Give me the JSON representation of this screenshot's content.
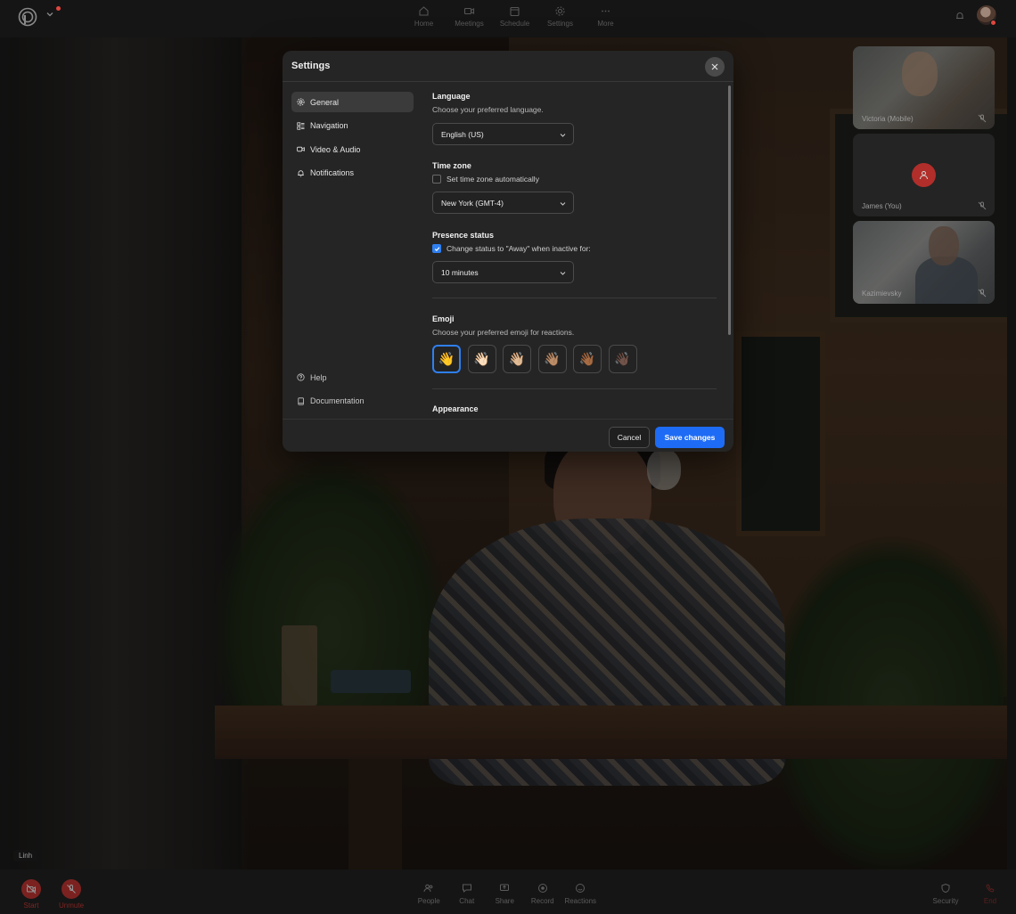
{
  "topbar": {
    "nav": [
      {
        "label": "Home",
        "icon": "home-icon"
      },
      {
        "label": "Meetings",
        "icon": "video-icon"
      },
      {
        "label": "Schedule",
        "icon": "calendar-icon"
      },
      {
        "label": "Settings",
        "icon": "gear-icon"
      },
      {
        "label": "More",
        "icon": "more-icon"
      }
    ]
  },
  "stage": {
    "speaker_name": "Linh"
  },
  "participants": [
    {
      "name": "Victoria (Mobile)"
    },
    {
      "name": "James (You)"
    },
    {
      "name": "Kazimievsky"
    }
  ],
  "modal": {
    "title": "Settings",
    "sidebar": {
      "items": [
        {
          "label": "General",
          "icon": "gear-icon",
          "active": true
        },
        {
          "label": "Navigation",
          "icon": "grid-list-icon",
          "active": false
        },
        {
          "label": "Video & Audio",
          "icon": "camera-icon",
          "active": false
        },
        {
          "label": "Notifications",
          "icon": "bell-icon",
          "active": false
        }
      ],
      "bottom": [
        {
          "label": "Help",
          "icon": "help-circle-icon"
        },
        {
          "label": "Documentation",
          "icon": "book-icon"
        }
      ]
    },
    "language": {
      "title": "Language",
      "description": "Choose your preferred language.",
      "value": "English (US)"
    },
    "timezone": {
      "title": "Time zone",
      "auto_label": "Set time zone automatically",
      "auto_checked": false,
      "value": "New York (GMT-4)"
    },
    "presence": {
      "title": "Presence status",
      "away_label": "Change status to \"Away\" when inactive for:",
      "away_checked": true,
      "value": "10 minutes"
    },
    "emoji": {
      "title": "Emoji",
      "description": "Choose your preferred emoji for reactions.",
      "options": [
        "👋",
        "👋🏻",
        "👋🏼",
        "👋🏽",
        "👋🏾",
        "👋🏿"
      ],
      "selected_index": 0
    },
    "appearance": {
      "title": "Appearance"
    },
    "footer": {
      "cancel_label": "Cancel",
      "save_label": "Save changes"
    }
  },
  "bottombar": {
    "left": [
      {
        "label": "Start",
        "icon": "video-off-icon"
      },
      {
        "label": "Unmute",
        "icon": "mic-off-icon"
      }
    ],
    "center": [
      {
        "label": "People",
        "icon": "people-icon"
      },
      {
        "label": "Chat",
        "icon": "chat-icon"
      },
      {
        "label": "Share",
        "icon": "share-screen-icon"
      },
      {
        "label": "Record",
        "icon": "record-icon"
      },
      {
        "label": "Reactions",
        "icon": "smile-icon"
      }
    ],
    "right": [
      {
        "label": "Security",
        "icon": "shield-icon"
      },
      {
        "label": "End",
        "icon": "phone-end-icon"
      }
    ]
  },
  "colors": {
    "accent": "#1e6cf5",
    "danger": "#d5312c",
    "modal_bg": "#252525"
  }
}
